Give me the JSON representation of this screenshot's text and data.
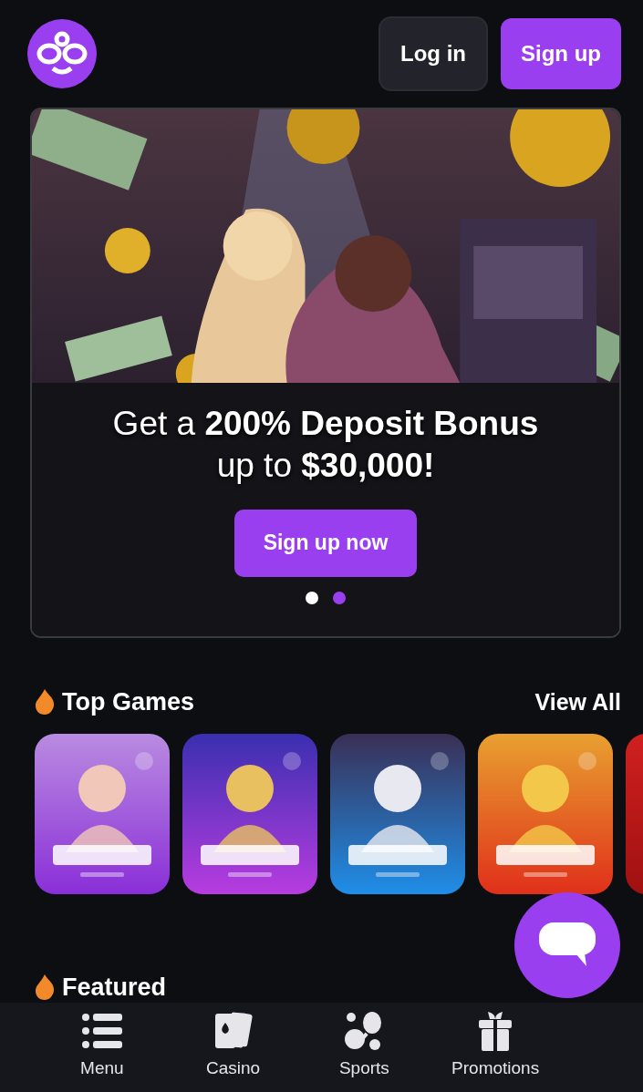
{
  "header": {
    "buttons": [
      {
        "label": "Log in",
        "kind": "secondary"
      },
      {
        "label": "Sign up",
        "kind": "primary"
      }
    ]
  },
  "banner": {
    "kind": "picture",
    "headline": "Get a **200% Deposit Bonus**",
    "subline": "up to **$30,000!**",
    "button": "Sign up now",
    "dots": [
      {
        "selected": true
      },
      {
        "selected": false
      }
    ]
  },
  "sections": [
    {
      "title": "Top Games",
      "link": "View All"
    },
    {
      "title": "Featured"
    }
  ],
  "bottom_nav": [
    {
      "label": "Menu",
      "kind": "menu"
    },
    {
      "label": "Casino",
      "kind": "casino"
    },
    {
      "label": "Sports",
      "kind": "sports"
    },
    {
      "label": "Promotions",
      "kind": "promotions"
    }
  ]
}
